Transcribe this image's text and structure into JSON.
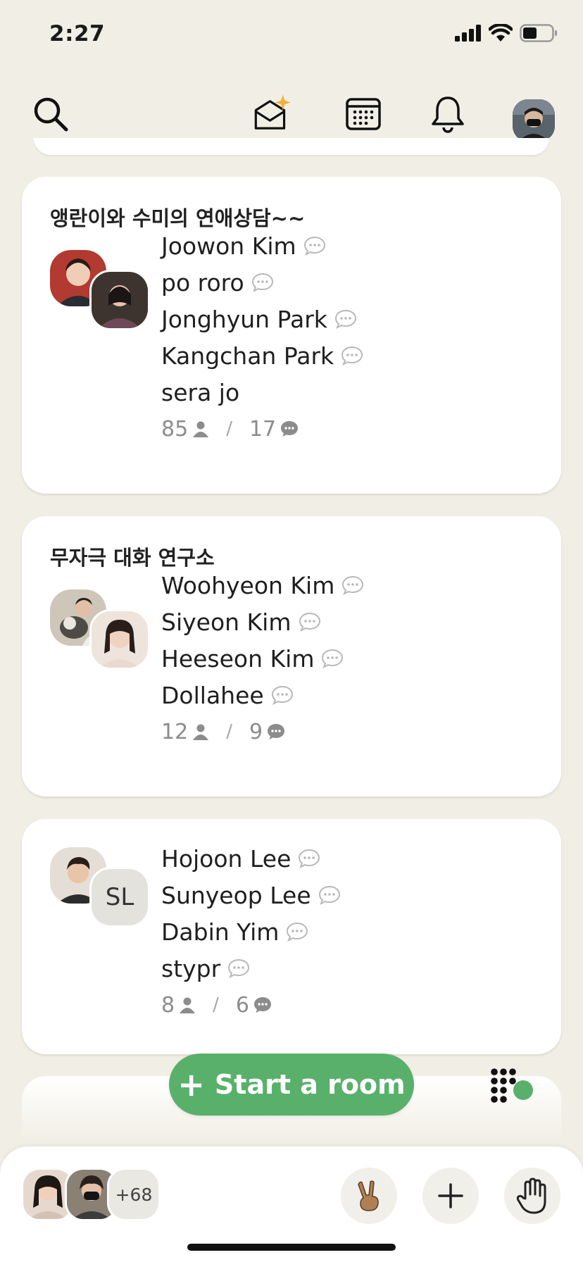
{
  "status": {
    "time": "2:27"
  },
  "nav": {
    "search_icon": "search-icon",
    "invite_icon": "envelope-sparkle-icon",
    "calendar_icon": "calendar-icon",
    "notifications_icon": "bell-icon"
  },
  "rooms": [
    {
      "title": "앵란이와 수미의 연애상담~~",
      "speakers": [
        "Joowon Kim",
        "po roro",
        "Jonghyun Park",
        "Kangchan Park",
        "sera jo"
      ],
      "speaker_bubbles": [
        true,
        true,
        true,
        true,
        false
      ],
      "listeners": "85",
      "chats": "17"
    },
    {
      "title": "무자극 대화 연구소",
      "speakers": [
        "Woohyeon Kim",
        "Siyeon Kim",
        "Heeseon Kim",
        "Dollahee"
      ],
      "speaker_bubbles": [
        true,
        true,
        true,
        true
      ],
      "listeners": "12",
      "chats": "9"
    },
    {
      "title": "",
      "avatar_initials": "SL",
      "speakers": [
        "Hojoon Lee",
        "Sunyeop Lee",
        "Dabin Yim",
        "stypr"
      ],
      "speaker_bubbles": [
        true,
        true,
        true,
        true
      ],
      "listeners": "8",
      "chats": "6"
    }
  ],
  "actions": {
    "start_room": "Start a room"
  },
  "bottom": {
    "more_count": "+68"
  },
  "colors": {
    "background": "#f1efe5",
    "accent_green": "#59b06b",
    "card": "#ffffff"
  }
}
